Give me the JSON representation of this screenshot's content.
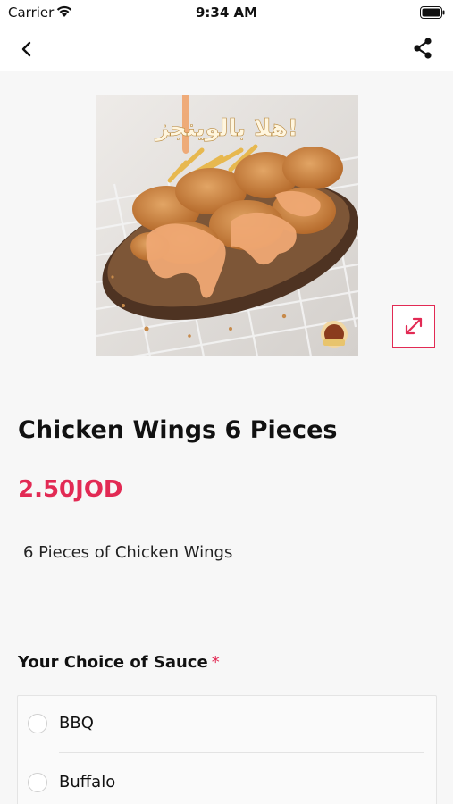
{
  "status_bar": {
    "carrier": "Carrier",
    "time": "9:34 AM"
  },
  "nav": {
    "back_icon": "chevron-left-icon",
    "share_icon": "share-icon"
  },
  "product": {
    "image_overlay_text": "هلا بالوينجز!",
    "title": "Chicken Wings 6 Pieces",
    "price": "2.50JOD",
    "description": "6 Pieces of Chicken Wings",
    "expand_icon": "expand-icon"
  },
  "sauce_section": {
    "title": "Your Choice of Sauce",
    "required_marker": "*",
    "options": [
      {
        "label": "BBQ",
        "selected": false
      },
      {
        "label": "Buffalo",
        "selected": false
      }
    ]
  },
  "colors": {
    "accent": "#e22a54",
    "background": "#f7f7f7"
  }
}
